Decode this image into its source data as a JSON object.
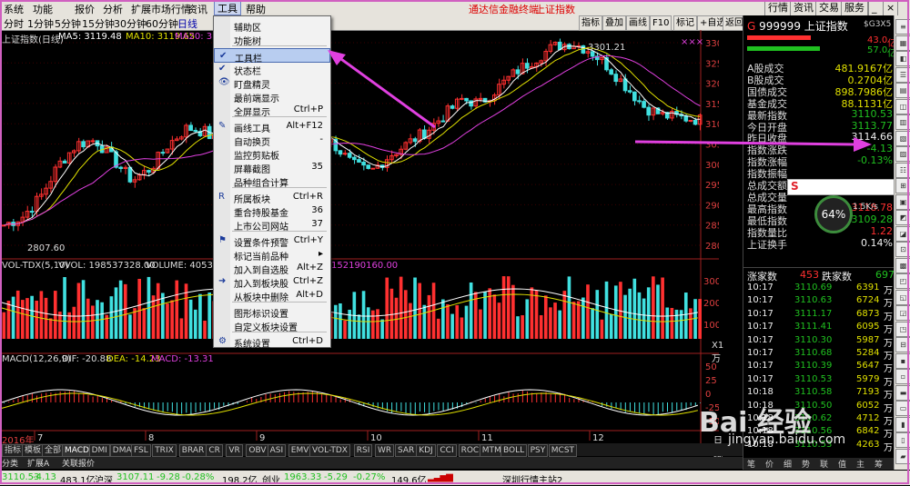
{
  "menubar": {
    "items": [
      "系统",
      "功能",
      "报价",
      "分析",
      "扩展市场行情",
      "资讯",
      "工具",
      "帮助"
    ],
    "active": "工具",
    "center_title": "通达信金融终端",
    "center_sub": "上证指数",
    "right_buttons": [
      "行情",
      "资讯",
      "交易",
      "服务"
    ]
  },
  "toolbar2": {
    "periods": [
      "分时",
      "1分钟",
      "5分钟",
      "15分钟",
      "30分钟",
      "60分钟",
      "日线"
    ],
    "right_tabs": [
      "指标",
      "叠加",
      "画线",
      "F10",
      "标记",
      "+自选",
      "返回"
    ]
  },
  "chart": {
    "title": "上证指数(日线)",
    "ma5": "MA5: 3119.48",
    "ma10": "MA10: 3119.65",
    "ma20": "MA20: 3124.",
    "high_label": "3301.21",
    "low_label": "2807.60",
    "vol_title": "VOL-TDX(5,10)",
    "vvol": "VVOL: 198537328.00",
    "volume": "VOLUME: 4053470",
    "vol_tail": "152190160.00",
    "macd_title": "MACD(12,26,9)",
    "dif": "DIF: -20.88",
    "dea": "DEA: -14.23",
    "macd": "MACD: -13.31",
    "year_label": "2016年",
    "month_labels": [
      "7",
      "8",
      "9",
      "10",
      "11",
      "12"
    ],
    "day_label": "日线",
    "vol_unit": "X1万",
    "price_ticks": [
      "3300",
      "3250",
      "3200",
      "3150",
      "3100",
      "3050",
      "3000",
      "2950",
      "2900",
      "2850",
      "2800"
    ],
    "vol_ticks": [
      "30000",
      "20000",
      "10000"
    ],
    "macd_ticks": [
      "50",
      "25",
      "0",
      "-25",
      "-50"
    ],
    "dots": "×××"
  },
  "dropdown": {
    "items": [
      {
        "label": "辅助区",
        "shortcut": "",
        "checked": false,
        "icon": ""
      },
      {
        "label": "功能树",
        "shortcut": "",
        "checked": false,
        "icon": ""
      },
      {
        "label": "工具栏",
        "shortcut": "",
        "checked": true,
        "icon": "",
        "highlight": true
      },
      {
        "label": "状态栏",
        "shortcut": "",
        "checked": true,
        "icon": ""
      },
      {
        "label": "盯盘精灵",
        "shortcut": "",
        "checked": false,
        "icon": "eye"
      },
      {
        "label": "最前端显示",
        "shortcut": "",
        "checked": false,
        "icon": ""
      },
      {
        "label": "全屏显示",
        "shortcut": "Ctrl+P",
        "checked": false,
        "icon": ""
      },
      {
        "label": "画线工具",
        "shortcut": "Alt+F12",
        "checked": false,
        "icon": "pen"
      },
      {
        "label": "自动换页",
        "shortcut": "-",
        "checked": false,
        "icon": ""
      },
      {
        "label": "监控剪贴板",
        "shortcut": "",
        "checked": false,
        "icon": ""
      },
      {
        "label": "屏幕截图",
        "shortcut": "35",
        "checked": false,
        "icon": ""
      },
      {
        "label": "品种组合计算",
        "shortcut": "",
        "checked": false,
        "icon": ""
      },
      {
        "label": "所属板块",
        "shortcut": "Ctrl+R",
        "checked": false,
        "icon": "R"
      },
      {
        "label": "重合持股基金",
        "shortcut": "36",
        "checked": false,
        "icon": ""
      },
      {
        "label": "上市公司网站",
        "shortcut": "37",
        "checked": false,
        "icon": ""
      },
      {
        "label": "设置条件预警",
        "shortcut": "Ctrl+Y",
        "checked": false,
        "icon": "bell"
      },
      {
        "label": "标记当前品种",
        "shortcut": "▸",
        "checked": false,
        "icon": ""
      },
      {
        "label": "加入到自选股",
        "shortcut": "Alt+Z",
        "checked": false,
        "icon": ""
      },
      {
        "label": "加入到板块股",
        "shortcut": "Ctrl+Z",
        "checked": false,
        "icon": "arrow"
      },
      {
        "label": "从板块中删除",
        "shortcut": "Alt+D",
        "checked": false,
        "icon": ""
      },
      {
        "label": "图形标识设置",
        "shortcut": "",
        "checked": false,
        "icon": ""
      },
      {
        "label": "自定义板块设置",
        "shortcut": "",
        "checked": false,
        "icon": ""
      },
      {
        "label": "系统设置",
        "shortcut": "Ctrl+D",
        "checked": false,
        "icon": "gear"
      }
    ]
  },
  "rpanel": {
    "code": "999999",
    "name": "上证指数",
    "tag": "$G3X5",
    "pct1": "43.0",
    "pct1_unit": "亿",
    "pct2": "57.0",
    "pct2_unit": "亿",
    "stats": [
      {
        "k": "A股成交",
        "v": "481.9167",
        "u": "亿",
        "color": "yellow"
      },
      {
        "k": "B股成交",
        "v": "0.2704",
        "u": "亿",
        "color": "yellow"
      },
      {
        "k": "国债成交",
        "v": "898.7986",
        "u": "亿",
        "color": "yellow"
      },
      {
        "k": "基金成交",
        "v": "88.1131",
        "u": "亿",
        "color": "yellow"
      },
      {
        "k": "最新指数",
        "v": "3110.53",
        "u": "",
        "color": "green"
      },
      {
        "k": "今日开盘",
        "v": "3113.77",
        "u": "",
        "color": "green"
      },
      {
        "k": "昨日收盘",
        "v": "3114.66",
        "u": "",
        "color": "white"
      },
      {
        "k": "指数涨跌",
        "v": "-4.13",
        "u": "",
        "color": "green"
      },
      {
        "k": "指数涨幅",
        "v": "-0.13%",
        "u": "",
        "color": "green"
      },
      {
        "k": "指数振幅",
        "v": "",
        "u": "",
        "color": "white"
      },
      {
        "k": "总成交额",
        "v": "",
        "u": "",
        "color": "white"
      },
      {
        "k": "总成交量",
        "v": "",
        "u": "",
        "color": "white"
      },
      {
        "k": "最高指数",
        "v": "3118.78",
        "u": "",
        "color": "red"
      },
      {
        "k": "最低指数",
        "v": "3109.28",
        "u": "",
        "color": "green"
      },
      {
        "k": "指数量比",
        "v": "1.22",
        "u": "",
        "color": "red"
      },
      {
        "k": "上证换手",
        "v": "0.14%",
        "u": "",
        "color": "white"
      }
    ],
    "rise_label": "涨家数",
    "rise_count": "453",
    "fall_label": "跌家数",
    "fall_count": "697",
    "ticks": [
      {
        "t": "10:17",
        "p": "3110.69",
        "v": "6391",
        "u": "万"
      },
      {
        "t": "10:17",
        "p": "3110.63",
        "v": "6724",
        "u": "万"
      },
      {
        "t": "10:17",
        "p": "3111.17",
        "v": "6873",
        "u": "万"
      },
      {
        "t": "10:17",
        "p": "3111.41",
        "v": "6095",
        "u": "万"
      },
      {
        "t": "10:17",
        "p": "3110.30",
        "v": "5987",
        "u": "万"
      },
      {
        "t": "10:17",
        "p": "3110.68",
        "v": "5284",
        "u": "万"
      },
      {
        "t": "10:17",
        "p": "3110.39",
        "v": "5647",
        "u": "万"
      },
      {
        "t": "10:17",
        "p": "3110.53",
        "v": "5979",
        "u": "万"
      },
      {
        "t": "10:18",
        "p": "3110.58",
        "v": "7193",
        "u": "万"
      },
      {
        "t": "10:18",
        "p": "3110.50",
        "v": "6052",
        "u": "万"
      },
      {
        "t": "10:18",
        "p": "3110.62",
        "v": "4712",
        "u": "万"
      },
      {
        "t": "10:18",
        "p": "3110.56",
        "v": "6842",
        "u": "万"
      },
      {
        "t": "10:18",
        "p": "3110.53",
        "v": "4263",
        "u": "万"
      }
    ],
    "bottom_tabs": [
      "笔",
      "价",
      "细",
      "势",
      "联",
      "值",
      "主",
      "筹"
    ],
    "widget_pct": "64%",
    "widget_speed": "1.5K/s"
  },
  "indicators": [
    "指标",
    "模板",
    "全部",
    "MACD",
    "DMI",
    "DMA",
    "FSL",
    "TRIX",
    "BRAR",
    "CR",
    "VR",
    "OBV",
    "ASI",
    "EMV",
    "VOL-TDX",
    "RSI",
    "WR",
    "SAR",
    "KDJ",
    "CCI",
    "ROC",
    "MTM",
    "BOLL",
    "PSY",
    "MCST"
  ],
  "bottom_tabs": [
    "分类",
    "扩展A",
    "关联报价"
  ],
  "status": {
    "sh_price": "3110.53",
    "sh_chg": "-4.13",
    "sh_amt": "483.1亿",
    "sz_label": "沪深",
    "sz_price": "3107.11",
    "sz_chg": "-9.28",
    "sz_pct": "-0.28%",
    "sz_amt": "198.2亿",
    "cy_label": "创业",
    "cy_price": "1963.33",
    "cy_chg": "-5.29",
    "cy_pct": "-0.27%",
    "cy_amt": "149.6亿",
    "server": "深圳行情主站2"
  },
  "watermark": {
    "brand": "Bai 经验",
    "url": "jingyan.baidu.com"
  },
  "colors": {
    "up": "#ff3030",
    "down": "#40e0e0",
    "ma5": "#ffffff",
    "ma10": "#e0e000",
    "ma20": "#e040e0",
    "arrow": "#e040e0"
  }
}
